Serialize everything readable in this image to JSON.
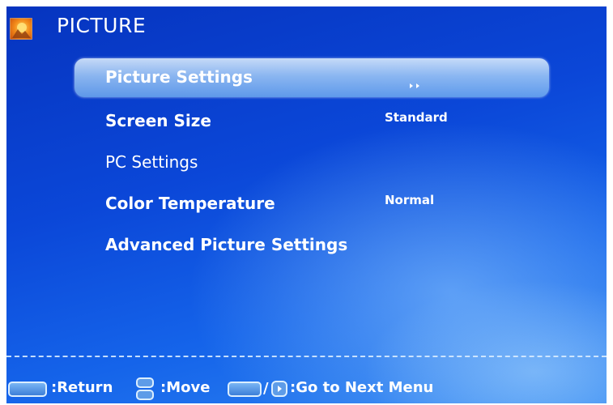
{
  "header": {
    "title": "PICTURE",
    "icon": "picture-icon"
  },
  "menu": {
    "items": [
      {
        "label": "Picture Settings",
        "value": "",
        "selected": true,
        "has_submenu": true
      },
      {
        "label": "Screen Size",
        "value": "Standard",
        "selected": false
      },
      {
        "label": "PC Settings",
        "value": "",
        "selected": false
      },
      {
        "label": "Color Temperature",
        "value": "Normal",
        "selected": false
      },
      {
        "label": "Advanced Picture Settings",
        "value": "",
        "selected": false
      }
    ]
  },
  "footer": {
    "return_text": ":Return",
    "move_text": ":Move",
    "next_text": ":Go to Next Menu",
    "menu_key": "MENU",
    "enter_key": "ENTER"
  },
  "colors": {
    "background": "#0b47d8",
    "highlight": "#b0d6f8",
    "text": "#ffffff"
  }
}
